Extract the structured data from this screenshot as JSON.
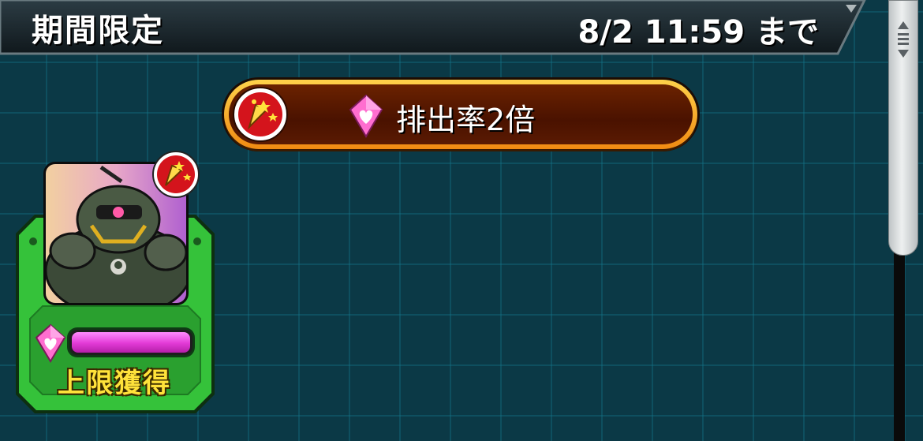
{
  "header": {
    "title": "期間限定",
    "deadline": "8/2 11:59 まで"
  },
  "banner": {
    "text": "排出率2倍",
    "icon": "party-popper-icon",
    "gem_icon": "heart-gem-icon"
  },
  "card": {
    "label": "上限獲得",
    "gauge_progress": 1.0,
    "badge_icon": "party-popper-icon",
    "portrait": "dark-green-armored-character"
  },
  "colors": {
    "accent_gold": "#ffd24a",
    "banner_fill": "#4a1200",
    "card_green": "#35c23a",
    "gauge_pink": "#e23ad6",
    "label_yellow": "#ffe23a"
  }
}
